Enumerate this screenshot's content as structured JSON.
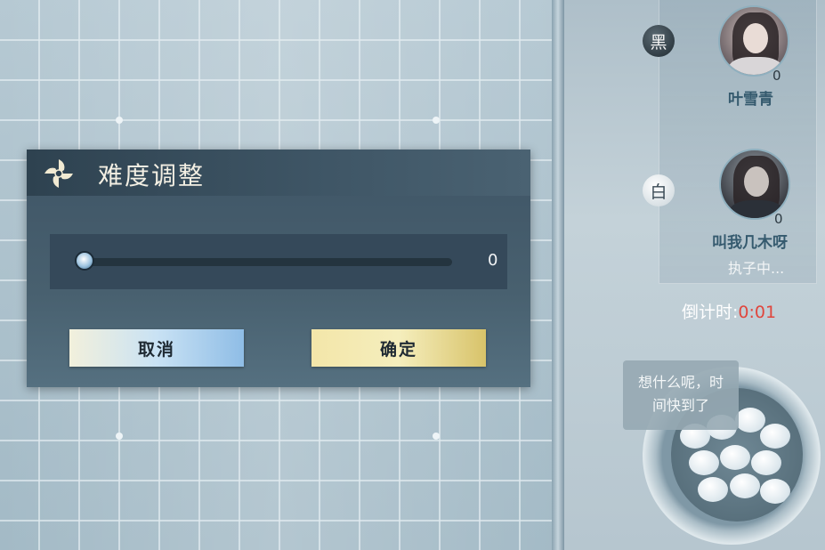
{
  "dialog": {
    "title": "难度调整",
    "icon": "pinwheel-icon",
    "slider_value": "0",
    "slider_level": 0,
    "cancel_label": "取消",
    "confirm_label": "确定"
  },
  "players": {
    "black": {
      "badge": "黑",
      "name": "叶雪青",
      "score": "0"
    },
    "white": {
      "badge": "白",
      "name": "叫我几木呀",
      "score": "0",
      "status": "执子中..."
    }
  },
  "timer": {
    "label": "倒计时:",
    "value": "0:01",
    "value_color": "#e0463d"
  },
  "chat_bubble": {
    "text_line1": "想什么呢，时",
    "text_line2": "间快到了"
  }
}
